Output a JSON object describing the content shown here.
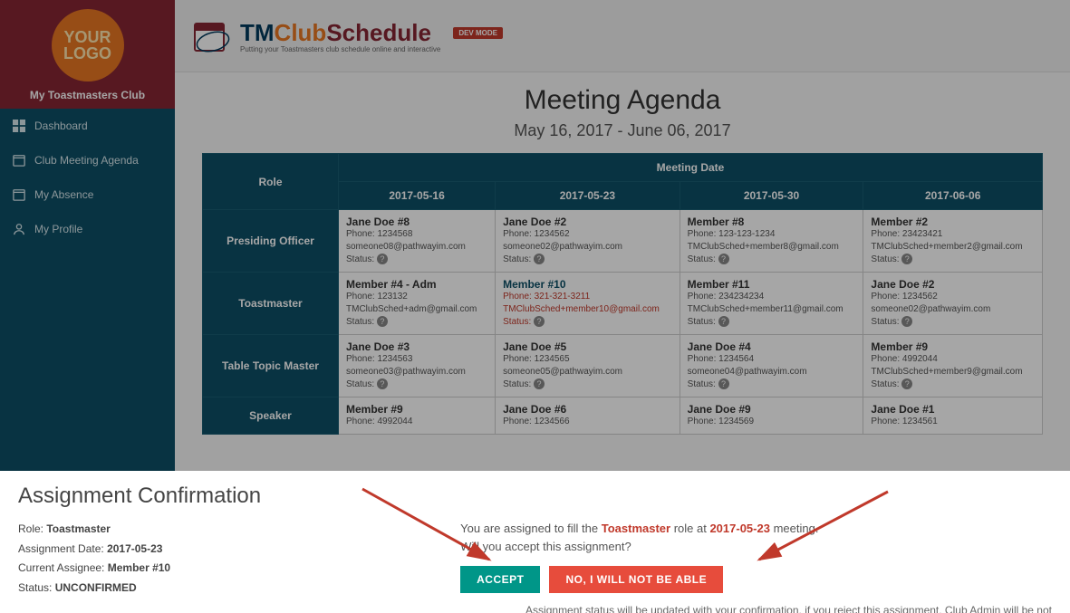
{
  "sidebar": {
    "logo_line1": "YOUR",
    "logo_line2": "LOGO",
    "club_name": "My Toastmasters Club",
    "items": [
      {
        "label": "Dashboard",
        "icon": "dashboard-icon"
      },
      {
        "label": "Club Meeting Agenda",
        "icon": "calendar-icon"
      },
      {
        "label": "My Absence",
        "icon": "calendar-x-icon"
      },
      {
        "label": "My Profile",
        "icon": "person-icon"
      }
    ]
  },
  "brand": {
    "tm": "TM",
    "club": "Club",
    "schedule": "Schedule",
    "tagline": "Putting your Toastmasters club schedule online and interactive",
    "dev_badge": "DEV MODE"
  },
  "page": {
    "title": "Meeting Agenda",
    "date_range": "May 16, 2017 - June 06, 2017",
    "role_header": "Role",
    "meeting_date_header": "Meeting Date",
    "columns": [
      "2017-05-16",
      "2017-05-23",
      "2017-05-30",
      "2017-06-06"
    ],
    "rows": [
      {
        "role": "Presiding Officer",
        "cells": [
          {
            "name": "Jane Doe #8",
            "phone": "Phone: 1234568",
            "email": "someone08@pathwayim.com",
            "status": "Status:"
          },
          {
            "name": "Jane Doe #2",
            "phone": "Phone: 1234562",
            "email": "someone02@pathwayim.com",
            "status": "Status:"
          },
          {
            "name": "Member #8",
            "phone": "Phone: 123-123-1234",
            "email": "TMClubSched+member8@gmail.com",
            "status": "Status:"
          },
          {
            "name": "Member #2",
            "phone": "Phone: 23423421",
            "email": "TMClubSched+member2@gmail.com",
            "status": "Status:"
          }
        ]
      },
      {
        "role": "Toastmaster",
        "cells": [
          {
            "name": "Member #4 - Adm",
            "phone": "Phone: 123132",
            "email": "TMClubSched+adm@gmail.com",
            "status": "Status:"
          },
          {
            "name": "Member #10",
            "phone": "Phone: 321-321-3211",
            "email": "TMClubSched+member10@gmail.com",
            "status": "Status:",
            "highlight": true
          },
          {
            "name": "Member #11",
            "phone": "Phone: 234234234",
            "email": "TMClubSched+member11@gmail.com",
            "status": "Status:"
          },
          {
            "name": "Jane Doe #2",
            "phone": "Phone: 1234562",
            "email": "someone02@pathwayim.com",
            "status": "Status:"
          }
        ]
      },
      {
        "role": "Table Topic Master",
        "cells": [
          {
            "name": "Jane Doe #3",
            "phone": "Phone: 1234563",
            "email": "someone03@pathwayim.com",
            "status": "Status:"
          },
          {
            "name": "Jane Doe #5",
            "phone": "Phone: 1234565",
            "email": "someone05@pathwayim.com",
            "status": "Status:"
          },
          {
            "name": "Jane Doe #4",
            "phone": "Phone: 1234564",
            "email": "someone04@pathwayim.com",
            "status": "Status:"
          },
          {
            "name": "Member #9",
            "phone": "Phone: 4992044",
            "email": "TMClubSched+member9@gmail.com",
            "status": "Status:"
          }
        ]
      },
      {
        "role": "Speaker",
        "cells": [
          {
            "name": "Member #9",
            "phone": "Phone: 4992044",
            "email": "",
            "status": ""
          },
          {
            "name": "Jane Doe #6",
            "phone": "Phone: 1234566",
            "email": "",
            "status": ""
          },
          {
            "name": "Jane Doe #9",
            "phone": "Phone: 1234569",
            "email": "",
            "status": ""
          },
          {
            "name": "Jane Doe #1",
            "phone": "Phone: 1234561",
            "email": "",
            "status": ""
          }
        ]
      }
    ]
  },
  "confirm": {
    "title": "Assignment Confirmation",
    "role_label": "Role:",
    "role_value": "Toastmaster",
    "date_label": "Assignment Date:",
    "date_value": "2017-05-23",
    "assignee_label": "Current Assignee:",
    "assignee_value": "Member #10",
    "status_label": "Status:",
    "status_value": "UNCONFIRMED",
    "msg_prefix": "You are assigned to fill the ",
    "msg_role": "Toastmaster",
    "msg_mid": " role at ",
    "msg_date": "2017-05-23",
    "msg_suffix": " meeting.",
    "msg_question": "Will you accept this assignment?",
    "accept_label": "ACCEPT",
    "reject_label": "NO, I WILL NOT BE ABLE",
    "note": "Assignment status will be updated with your confirmation, if you reject this assignment, Club Admin will be not"
  }
}
